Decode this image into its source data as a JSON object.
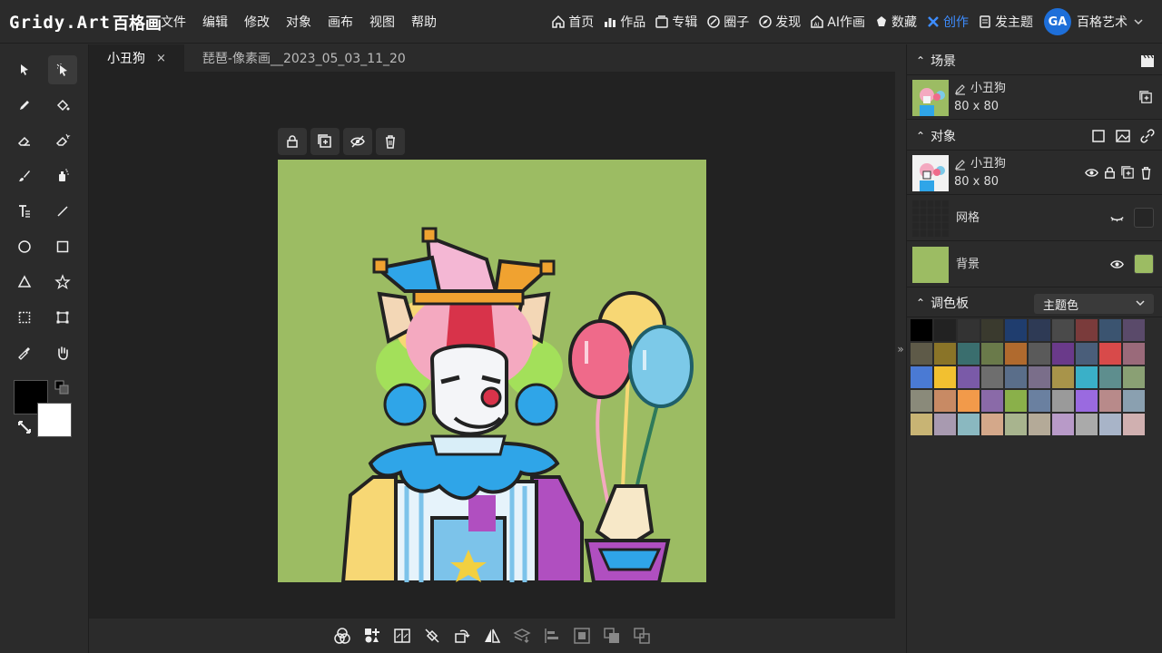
{
  "app": {
    "logo_text": "Gridy.Art",
    "logo_cn": "百格画"
  },
  "menu": [
    "文件",
    "编辑",
    "修改",
    "对象",
    "画布",
    "视图",
    "帮助"
  ],
  "nav": [
    {
      "label": "首页",
      "icon": "home-icon"
    },
    {
      "label": "作品",
      "icon": "chart-icon"
    },
    {
      "label": "专辑",
      "icon": "album-icon"
    },
    {
      "label": "圈子",
      "icon": "circle-icon"
    },
    {
      "label": "发现",
      "icon": "compass-icon"
    },
    {
      "label": "AI作画",
      "icon": "ai-paint-icon"
    },
    {
      "label": "数藏",
      "icon": "collect-icon"
    },
    {
      "label": "创作",
      "icon": "create-icon",
      "active": true
    },
    {
      "label": "发主题",
      "icon": "post-icon"
    }
  ],
  "user": {
    "avatar_text": "GA",
    "name": "百格艺术"
  },
  "tabs": [
    {
      "label": "小丑狗",
      "active": true,
      "close": "×"
    },
    {
      "label": "琵琶-像素画__2023_05_03_11_20",
      "active": false
    }
  ],
  "scene": {
    "title": "场景",
    "name": "小丑狗",
    "size": "80 x 80"
  },
  "objects": {
    "title": "对象",
    "name": "小丑狗",
    "size": "80 x 80"
  },
  "grid_layer": {
    "label": "网格"
  },
  "bg_layer": {
    "label": "背景",
    "color": "#9cbc63"
  },
  "palette": {
    "title": "调色板",
    "selected": "主题色",
    "colors": [
      "#000000",
      "#222222",
      "#333333",
      "#3a3a2e",
      "#1f3d6e",
      "#2e3a55",
      "#4a4a4a",
      "#7a3b3b",
      "#3b5470",
      "#5a4a6a",
      "#5e5a48",
      "#8a7428",
      "#3a6e6e",
      "#6a7a4a",
      "#b06a2e",
      "#5a5a5a",
      "#6a3a8a",
      "#4a5e7a",
      "#d84a4a",
      "#9a6a7a",
      "#4a7ad4",
      "#f2c030",
      "#7a5aa8",
      "#6e6e6e",
      "#5a6e8a",
      "#7a6e8a",
      "#a8944a",
      "#3ab0c8",
      "#5e8e8e",
      "#8aa074",
      "#8a8a7a",
      "#c88a64",
      "#f29a4a",
      "#8a6aa8",
      "#8ab04a",
      "#6a80a0",
      "#9a9a9a",
      "#9a6ae0",
      "#b88a8a",
      "#8aa0b0",
      "#c8b474",
      "#a89ab0",
      "#8ab8c0",
      "#d4a88a",
      "#a8b48e",
      "#b4aa98",
      "#b89ac8",
      "#aaaaaa",
      "#a8b4c8",
      "#d0b0b0"
    ]
  },
  "colors": {
    "accent": "#3e8dff",
    "fg": "#000000",
    "bg": "#ffffff",
    "canvas_bg": "#9cbc63"
  }
}
